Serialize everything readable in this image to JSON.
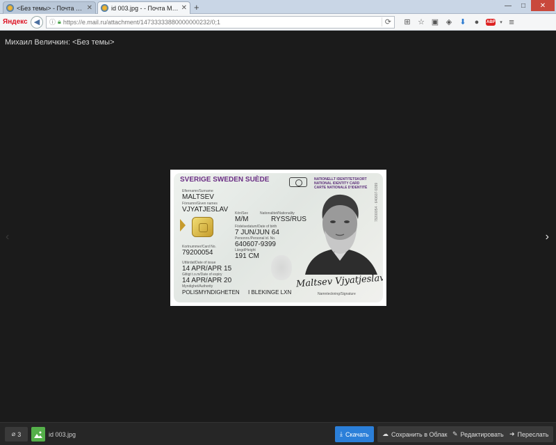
{
  "browser": {
    "tabs": [
      {
        "title": "<Без темы> - Почта Mail.R...",
        "active": false
      },
      {
        "title": "id 003.jpg - - Почта Mail.Ru",
        "active": true
      }
    ],
    "new_tab_label": "+",
    "window_controls": {
      "minimize": "—",
      "maximize": "□",
      "close": "✕"
    },
    "logo": "Яндекс",
    "url": "https://e.mail.ru/attachment/14733333880000000232/0;1",
    "toolbar_icons": [
      "reload-icon",
      "rss-icon",
      "star-icon",
      "clipboard-icon",
      "pocket-icon",
      "download-icon",
      "chat-icon",
      "adblock-icon",
      "menu-icon"
    ],
    "adblock_label": "ABP"
  },
  "viewer": {
    "title": "Михаил Величкин: <Без темы>",
    "prev_arrow": "‹",
    "next_arrow": "›"
  },
  "card": {
    "header": "SVERIGE SWEDEN SUÈDE",
    "national_caption": [
      "NATIONELLT IDENTITETSKORT",
      "NATIONAL IDENTITY CARD",
      "CARTE NATIONALE D'IDENTITÉ"
    ],
    "surname_caption": "Efternamn/Surname",
    "surname": "MALTSEV",
    "given_caption": "Förnamn/Given names",
    "given_names": "VJYATJESLAV",
    "sex_caption": "Kön/Sex",
    "sex": "M/M",
    "nationality_caption": "Nationalitet/Nationality",
    "nationality": "RYSS/RUS",
    "dob_caption": "Födelsedatum/Date of birth",
    "dob": "7 JUN/JUN 64",
    "personal_caption": "Personnr./Personal id. No.",
    "personal_no": "640607-9399",
    "height_caption": "Längd/Height",
    "height": "191 CM",
    "card_no_caption": "Kortnummer/Card No.",
    "card_no": "79200054",
    "issue_caption": "Utfärdat/Date of issue",
    "issue_date": "14 APR/APR 15",
    "expiry_caption": "Giltigt t.o.m/Date of expiry",
    "expiry_date": "14 APR/APR 20",
    "authority_caption": "Myndighet/Authority",
    "authority": "POLISMYNDIGHETEN",
    "county": "I BLEKINGE LXN",
    "signature": "Maltsev Vjyatjeslav",
    "signature_caption": "Namnteckning/Signature",
    "vertical_number": "79200054 · 640607-9399"
  },
  "bottom_bar": {
    "attachments_count": "3",
    "file_name": "id 003.jpg",
    "download": "Скачать",
    "save_cloud": "Сохранить в Облако",
    "edit": "Редактировать",
    "forward": "Переслать"
  },
  "colors": {
    "background": "#1b1b1b",
    "primary_button": "#2b7fd9",
    "card_header": "#6a2e84"
  }
}
